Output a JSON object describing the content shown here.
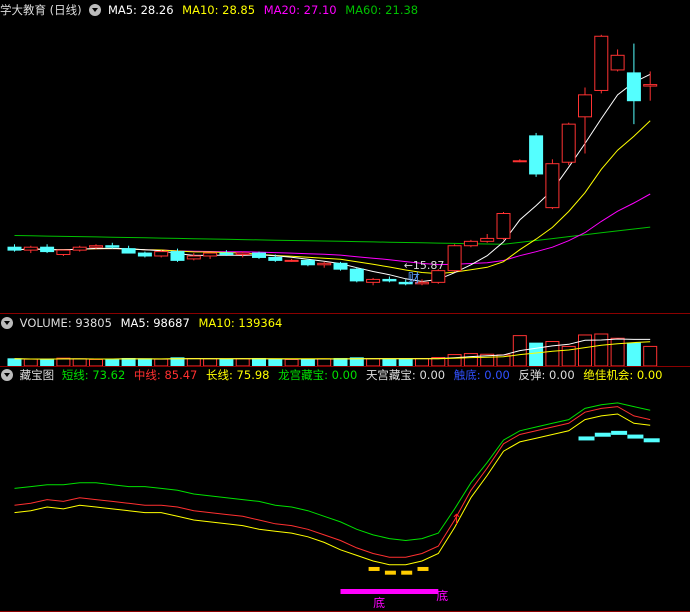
{
  "price_panel": {
    "title": "学大教育 (日线)",
    "ma5_label": "MA5: 28.26",
    "ma10_label": "MA10: 28.85",
    "ma20_label": "MA20: 27.10",
    "ma60_label": "MA60: 21.38",
    "low_marker": "15.87",
    "cai_marker": "财"
  },
  "volume_panel": {
    "vol_label": "VOLUME: 93805",
    "ma5_label": "MA5: 98687",
    "ma10_label": "MA10: 139364"
  },
  "indicator_panel": {
    "name": "藏宝图",
    "short_label": "短线: 73.62",
    "mid_label": "中线: 85.47",
    "long_label": "长线: 75.98",
    "dragon_label": "龙宫藏宝: 0.00",
    "sky_label": "天宫藏宝: 0.00",
    "touch_label": "触底: 0.00",
    "rebound_label": "反弹: 0.00",
    "chance_label": "绝佳机会: 0.00",
    "bottom_marker_1": "底",
    "bottom_marker_2": "底"
  },
  "colors": {
    "up": "#ff3232",
    "down": "#54ffff",
    "ma5": "#ffffff",
    "ma10": "#ffff00",
    "ma20": "#ff00ff",
    "ma60": "#00c000",
    "separator": "#8b0000"
  },
  "chart_data": {
    "type": "candlestick",
    "candles": [
      {
        "o": 16.4,
        "h": 16.6,
        "l": 16.1,
        "c": 16.2
      },
      {
        "o": 16.2,
        "h": 16.5,
        "l": 16.0,
        "c": 16.4
      },
      {
        "o": 16.4,
        "h": 16.6,
        "l": 16.0,
        "c": 16.1
      },
      {
        "o": 15.9,
        "h": 16.2,
        "l": 15.8,
        "c": 16.2
      },
      {
        "o": 16.2,
        "h": 16.5,
        "l": 16.1,
        "c": 16.4
      },
      {
        "o": 16.4,
        "h": 16.6,
        "l": 16.3,
        "c": 16.5
      },
      {
        "o": 16.5,
        "h": 16.7,
        "l": 16.3,
        "c": 16.4
      },
      {
        "o": 16.3,
        "h": 16.5,
        "l": 16.0,
        "c": 16.0
      },
      {
        "o": 16.0,
        "h": 16.1,
        "l": 15.7,
        "c": 15.8
      },
      {
        "o": 15.8,
        "h": 16.2,
        "l": 15.7,
        "c": 16.1
      },
      {
        "o": 16.1,
        "h": 16.3,
        "l": 15.4,
        "c": 15.5
      },
      {
        "o": 15.6,
        "h": 16.0,
        "l": 15.5,
        "c": 15.8
      },
      {
        "o": 15.8,
        "h": 16.0,
        "l": 15.6,
        "c": 16.0
      },
      {
        "o": 16.0,
        "h": 16.2,
        "l": 15.8,
        "c": 15.9
      },
      {
        "o": 15.9,
        "h": 16.1,
        "l": 15.7,
        "c": 16.0
      },
      {
        "o": 16.0,
        "h": 16.1,
        "l": 15.6,
        "c": 15.7
      },
      {
        "o": 15.7,
        "h": 15.9,
        "l": 15.4,
        "c": 15.5
      },
      {
        "o": 15.5,
        "h": 15.6,
        "l": 15.4,
        "c": 15.5
      },
      {
        "o": 15.5,
        "h": 15.6,
        "l": 15.1,
        "c": 15.2
      },
      {
        "o": 15.2,
        "h": 15.4,
        "l": 15.0,
        "c": 15.3
      },
      {
        "o": 15.3,
        "h": 15.4,
        "l": 14.8,
        "c": 14.9
      },
      {
        "o": 14.9,
        "h": 15.0,
        "l": 14.0,
        "c": 14.1
      },
      {
        "o": 14.0,
        "h": 14.3,
        "l": 13.8,
        "c": 14.2
      },
      {
        "o": 14.2,
        "h": 14.4,
        "l": 14.0,
        "c": 14.1
      },
      {
        "o": 14.0,
        "h": 14.2,
        "l": 13.8,
        "c": 13.9
      },
      {
        "o": 13.9,
        "h": 14.2,
        "l": 13.8,
        "c": 14.0
      },
      {
        "o": 14.0,
        "h": 14.9,
        "l": 13.9,
        "c": 14.8
      },
      {
        "o": 14.8,
        "h": 16.6,
        "l": 14.7,
        "c": 16.5
      },
      {
        "o": 16.5,
        "h": 16.9,
        "l": 16.4,
        "c": 16.8
      },
      {
        "o": 16.8,
        "h": 17.3,
        "l": 16.7,
        "c": 17.0
      },
      {
        "o": 17.0,
        "h": 18.8,
        "l": 16.9,
        "c": 18.7
      },
      {
        "o": 22.3,
        "h": 22.4,
        "l": 22.2,
        "c": 22.3
      },
      {
        "o": 24.0,
        "h": 24.2,
        "l": 21.2,
        "c": 21.4
      },
      {
        "o": 19.1,
        "h": 22.4,
        "l": 19.0,
        "c": 22.1
      },
      {
        "o": 22.2,
        "h": 24.9,
        "l": 22.0,
        "c": 24.8
      },
      {
        "o": 25.3,
        "h": 27.3,
        "l": 22.8,
        "c": 26.8
      },
      {
        "o": 27.1,
        "h": 30.9,
        "l": 26.9,
        "c": 30.8
      },
      {
        "o": 28.5,
        "h": 29.9,
        "l": 28.4,
        "c": 29.5
      },
      {
        "o": 28.3,
        "h": 30.3,
        "l": 24.8,
        "c": 26.4
      },
      {
        "o": 27.4,
        "h": 28.4,
        "l": 26.4,
        "c": 27.5
      }
    ],
    "low_label_value": 15.87,
    "volume": [
      22,
      21,
      20,
      24,
      22,
      20,
      21,
      23,
      22,
      21,
      25,
      23,
      22,
      21,
      22,
      23,
      21,
      20,
      21,
      22,
      23,
      25,
      22,
      21,
      22,
      23,
      26,
      35,
      38,
      36,
      34,
      93,
      70,
      75,
      60,
      95,
      98,
      85,
      70,
      60
    ],
    "indicator": {
      "short": [
        40,
        41,
        43,
        42,
        44,
        43,
        42,
        41,
        40,
        40,
        38,
        36,
        35,
        34,
        33,
        31,
        30,
        29,
        27,
        24,
        20,
        17,
        14,
        12,
        12,
        14,
        18,
        32,
        48,
        60,
        73,
        78,
        80,
        82,
        84,
        90,
        92,
        93,
        88,
        87
      ],
      "mid": [
        44,
        45,
        47,
        46,
        48,
        47,
        46,
        45,
        44,
        44,
        43,
        41,
        40,
        39,
        38,
        36,
        34,
        33,
        31,
        28,
        25,
        21,
        18,
        16,
        16,
        18,
        22,
        36,
        52,
        64,
        77,
        82,
        84,
        86,
        88,
        94,
        96,
        97,
        92,
        90
      ],
      "long": [
        53,
        54,
        55,
        55,
        56,
        56,
        55,
        54,
        54,
        53,
        52,
        50,
        49,
        48,
        47,
        46,
        44,
        43,
        41,
        38,
        35,
        31,
        28,
        26,
        25,
        26,
        29,
        42,
        56,
        67,
        79,
        84,
        86,
        88,
        90,
        96,
        98,
        99,
        97,
        95
      ]
    }
  }
}
